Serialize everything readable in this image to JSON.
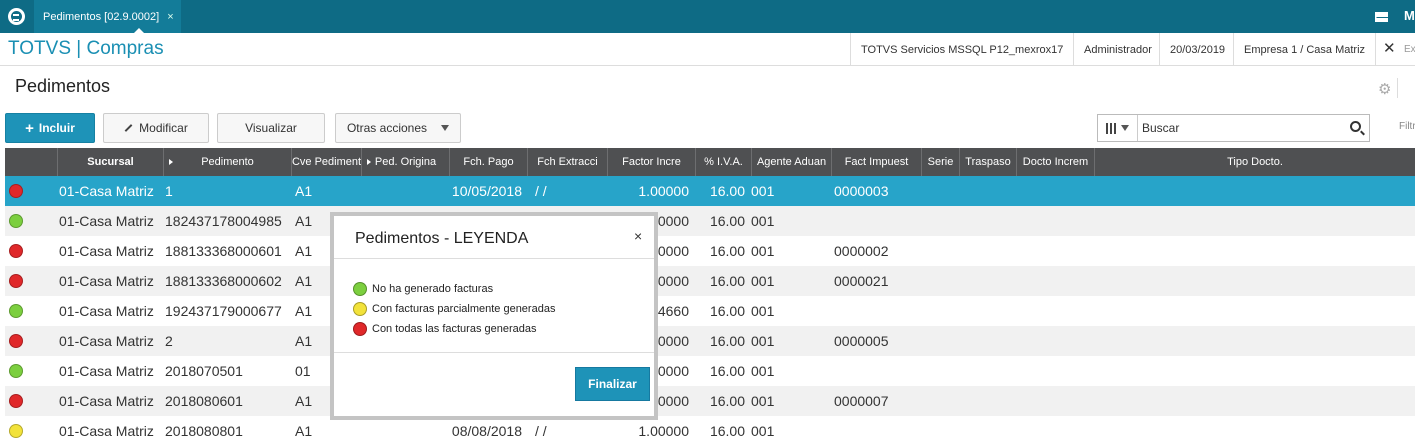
{
  "topbar": {
    "tab_title": "Pedimentos [02.9.0002]",
    "tab_close": "×",
    "extra_icon": "M"
  },
  "header": {
    "app_title": "TOTVS | Compras",
    "server": "TOTVS Servicios MSSQL P12_mexrox17",
    "user": "Administrador",
    "date": "20/03/2019",
    "company": "Empresa 1 / Casa Matriz",
    "close": "✕",
    "exit_label": "Ex"
  },
  "page": {
    "title": "Pedimentos",
    "gear": "⚙"
  },
  "toolbar": {
    "incluir_plus": "+",
    "incluir": "Incluir",
    "modificar": "Modificar",
    "visualizar": "Visualizar",
    "otras": "Otras acciones"
  },
  "search": {
    "placeholder": "Buscar",
    "filter_label": "Filtr"
  },
  "colors": {
    "accent": "#1e93b8",
    "topbar": "#0e6b85",
    "selected_row": "#27a4c9",
    "green": "#7ccf3f",
    "yellow": "#f2e23a",
    "red": "#e0282a"
  },
  "grid": {
    "columns": [
      "Sucursal",
      "Pedimento",
      "Cve Pediment",
      "Ped. Origina",
      "Fch. Pago",
      "Fch Extracci",
      "Factor Incre",
      "% I.V.A.",
      "Agente Aduan",
      "Fact Impuest",
      "Serie",
      "Traspaso",
      "Docto Increm",
      "Tipo Docto."
    ],
    "rows": [
      {
        "status": "red",
        "sucursal": "01-Casa Matriz",
        "pedimento": "1",
        "cve": "A1",
        "ped_orig": "",
        "fch_pago": "10/05/2018",
        "fch_extr": " /  /",
        "factor": "1.00000",
        "iva": "16.00",
        "agente": "001",
        "fact_imp": "0000003"
      },
      {
        "status": "green",
        "sucursal": "01-Casa Matriz",
        "pedimento": "182437178004985",
        "cve": "A1",
        "ped_orig": "",
        "fch_pago": "",
        "fch_extr": "",
        "factor": "0000",
        "iva": "16.00",
        "agente": "001",
        "fact_imp": ""
      },
      {
        "status": "red",
        "sucursal": "01-Casa Matriz",
        "pedimento": "188133368000601",
        "cve": "A1",
        "ped_orig": "",
        "fch_pago": "",
        "fch_extr": "",
        "factor": "0000",
        "iva": "16.00",
        "agente": "001",
        "fact_imp": "0000002"
      },
      {
        "status": "red",
        "sucursal": "01-Casa Matriz",
        "pedimento": "188133368000602",
        "cve": "A1",
        "ped_orig": "",
        "fch_pago": "",
        "fch_extr": "",
        "factor": "0000",
        "iva": "16.00",
        "agente": "001",
        "fact_imp": "0000021"
      },
      {
        "status": "green",
        "sucursal": "01-Casa Matriz",
        "pedimento": "192437179000677",
        "cve": "A1",
        "ped_orig": "",
        "fch_pago": "",
        "fch_extr": "",
        "factor": "4660",
        "iva": "16.00",
        "agente": "001",
        "fact_imp": ""
      },
      {
        "status": "red",
        "sucursal": "01-Casa Matriz",
        "pedimento": "2",
        "cve": "A1",
        "ped_orig": "",
        "fch_pago": "",
        "fch_extr": "",
        "factor": "0000",
        "iva": "16.00",
        "agente": "001",
        "fact_imp": "0000005"
      },
      {
        "status": "green",
        "sucursal": "01-Casa Matriz",
        "pedimento": "2018070501",
        "cve": "01",
        "ped_orig": "",
        "fch_pago": "",
        "fch_extr": "",
        "factor": "0000",
        "iva": "16.00",
        "agente": "001",
        "fact_imp": ""
      },
      {
        "status": "red",
        "sucursal": "01-Casa Matriz",
        "pedimento": "2018080601",
        "cve": "A1",
        "ped_orig": "",
        "fch_pago": "",
        "fch_extr": "",
        "factor": "0000",
        "iva": "16.00",
        "agente": "001",
        "fact_imp": "0000007"
      },
      {
        "status": "yellow",
        "sucursal": "01-Casa Matriz",
        "pedimento": "2018080801",
        "cve": "A1",
        "ped_orig": "",
        "fch_pago": "08/08/2018",
        "fch_extr": " /  /",
        "factor": "1.00000",
        "iva": "16.00",
        "agente": "001",
        "fact_imp": ""
      }
    ]
  },
  "modal": {
    "title": "Pedimentos - LEYENDA",
    "close": "×",
    "legend": [
      {
        "color": "green",
        "label": "No ha generado facturas"
      },
      {
        "color": "yellow",
        "label": "Con facturas parcialmente generadas"
      },
      {
        "color": "red",
        "label": "Con todas las facturas generadas"
      }
    ],
    "button": "Finalizar"
  }
}
